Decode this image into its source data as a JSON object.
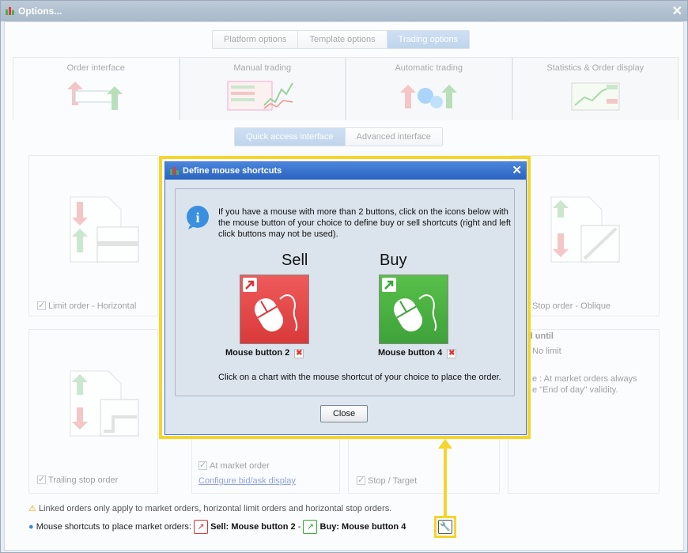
{
  "window": {
    "title": "Options..."
  },
  "top_tabs": [
    {
      "label": "Platform options",
      "active": false
    },
    {
      "label": "Template options",
      "active": false
    },
    {
      "label": "Trading options",
      "active": true
    }
  ],
  "big_tabs": [
    {
      "label": "Order interface",
      "active": true
    },
    {
      "label": "Manual trading",
      "active": false
    },
    {
      "label": "Automatic trading",
      "active": false
    },
    {
      "label": "Statistics & Order display",
      "active": false
    }
  ],
  "sub_tabs": [
    {
      "label": "Quick access interface",
      "active": true
    },
    {
      "label": "Advanced interface",
      "active": false
    }
  ],
  "panels": {
    "limit_order_horizontal": "Limit order - Horizontal",
    "stop_order_oblique": "Stop order - Oblique",
    "trailing_stop_order": "Trailing stop order",
    "at_market_order": "At market order",
    "configure_link": "Configure bid/ask display",
    "stop_target": "Stop / Target",
    "valid_until_heading": "d until",
    "no_limit": "No limit",
    "market_note": "e : At market orders always",
    "market_note2": "e \"End of day\" validity."
  },
  "footer": {
    "linked_orders": "Linked orders only apply to market orders, horizontal limit orders and horizontal stop orders.",
    "mouse_shortcuts_label": "Mouse shortcuts to place market orders:",
    "sell_label": "Sell:",
    "sell_value": "Mouse button 2",
    "separator": "-",
    "buy_label": "Buy:",
    "buy_value": "Mouse button 4"
  },
  "dialog": {
    "title": "Define mouse shortcuts",
    "info": "If you have a mouse with more than 2 buttons, click on the icons below with the mouse button of your choice to define buy or sell shortcuts (right and left click buttons may not be used).",
    "sell_heading": "Sell",
    "buy_heading": "Buy",
    "sell_button": "Mouse button 2",
    "buy_button": "Mouse button 4",
    "hint": "Click on a chart with the mouse shortcut of your choice to place the order.",
    "close_label": "Close"
  },
  "colors": {
    "sell": "#d93a3a",
    "buy": "#3ea23a",
    "highlight": "#f5d52b",
    "dialog_title": "#2b62c0",
    "tab_active": "#8fb4df"
  }
}
